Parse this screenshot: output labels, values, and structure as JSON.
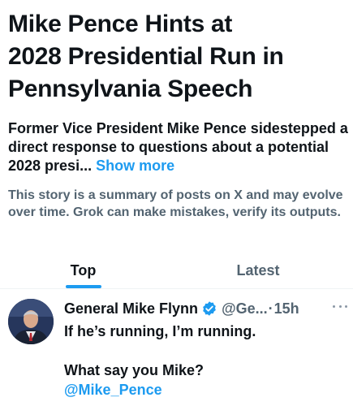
{
  "headline": {
    "line1": "Mike Pence Hints at",
    "line2": "2028 Presidential Run in",
    "line3": "Pennsylvania Speech"
  },
  "summary": {
    "text": "Former Vice President Mike Pence sidestepped a direct response to questions about a potential 2028 presi...",
    "show_more": "Show more"
  },
  "disclaimer": "This story is a summary of posts on X and may evolve over time. Grok can make mistakes, verify its outputs.",
  "tabs": [
    {
      "label": "Top",
      "active": true
    },
    {
      "label": "Latest",
      "active": false
    }
  ],
  "post": {
    "author": "General Mike Flynn",
    "handle": "@Ge...",
    "separator": "·",
    "time": "15h",
    "line1": "If he’s running, I’m running.",
    "line2": "What say you Mike?",
    "mention": "@Mike_Pence"
  },
  "colors": {
    "accent": "#1d9bf0",
    "text": "#0f1419",
    "muted": "#536471",
    "divider": "#eff3f4"
  },
  "icons": [
    "verified-badge-icon",
    "more-options-icon",
    "avatar"
  ]
}
